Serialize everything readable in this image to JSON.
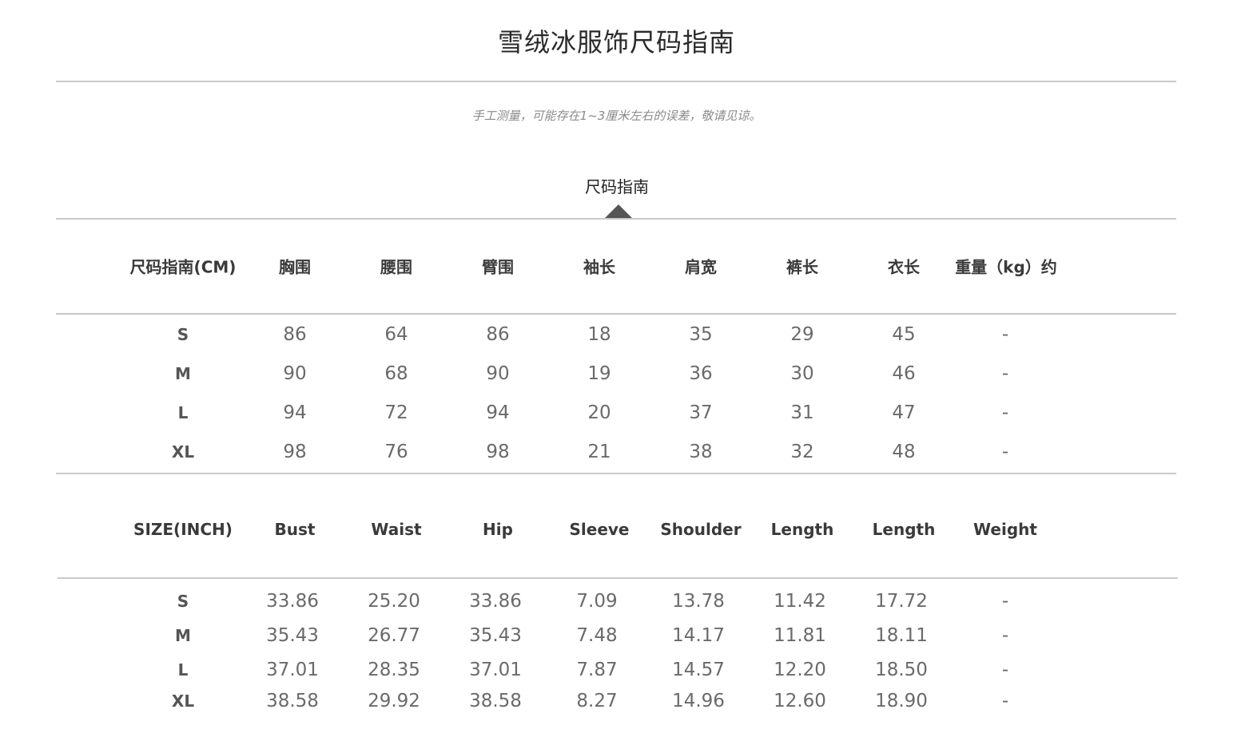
{
  "page": {
    "title": "雪绒冰服饰尺码指南",
    "note": "手工测量，可能存在1~3厘米左右的误差，敬请见谅。",
    "tab_label": "尺码指南"
  },
  "cm_table": {
    "headers": [
      "尺码指南(CM)",
      "胸围",
      "腰围",
      "臂围",
      "袖长",
      "肩宽",
      "裤长",
      "衣长",
      "重量（kg）约"
    ],
    "rows": [
      [
        "S",
        "86",
        "64",
        "86",
        "18",
        "35",
        "29",
        "45",
        "-"
      ],
      [
        "M",
        "90",
        "68",
        "90",
        "19",
        "36",
        "30",
        "46",
        "-"
      ],
      [
        "L",
        "94",
        "72",
        "94",
        "20",
        "37",
        "31",
        "47",
        "-"
      ],
      [
        "XL",
        "98",
        "76",
        "98",
        "21",
        "38",
        "32",
        "48",
        "-"
      ]
    ]
  },
  "inch_table": {
    "headers": [
      "SIZE(INCH)",
      "Bust",
      "Waist",
      "Hip",
      "Sleeve",
      "Shoulder",
      "Length",
      "Length",
      "Weight"
    ],
    "rows": [
      [
        "S",
        "33.86",
        "25.20",
        "33.86",
        "7.09",
        "13.78",
        "11.42",
        "17.72",
        "-"
      ],
      [
        "M",
        "35.43",
        "26.77",
        "35.43",
        "7.48",
        "14.17",
        "11.81",
        "18.11",
        "-"
      ],
      [
        "L",
        "37.01",
        "28.35",
        "37.01",
        "7.87",
        "14.57",
        "12.20",
        "18.50",
        "-"
      ],
      [
        "XL",
        "38.58",
        "29.92",
        "38.58",
        "8.27",
        "14.96",
        "12.60",
        "18.90",
        "-"
      ]
    ]
  }
}
